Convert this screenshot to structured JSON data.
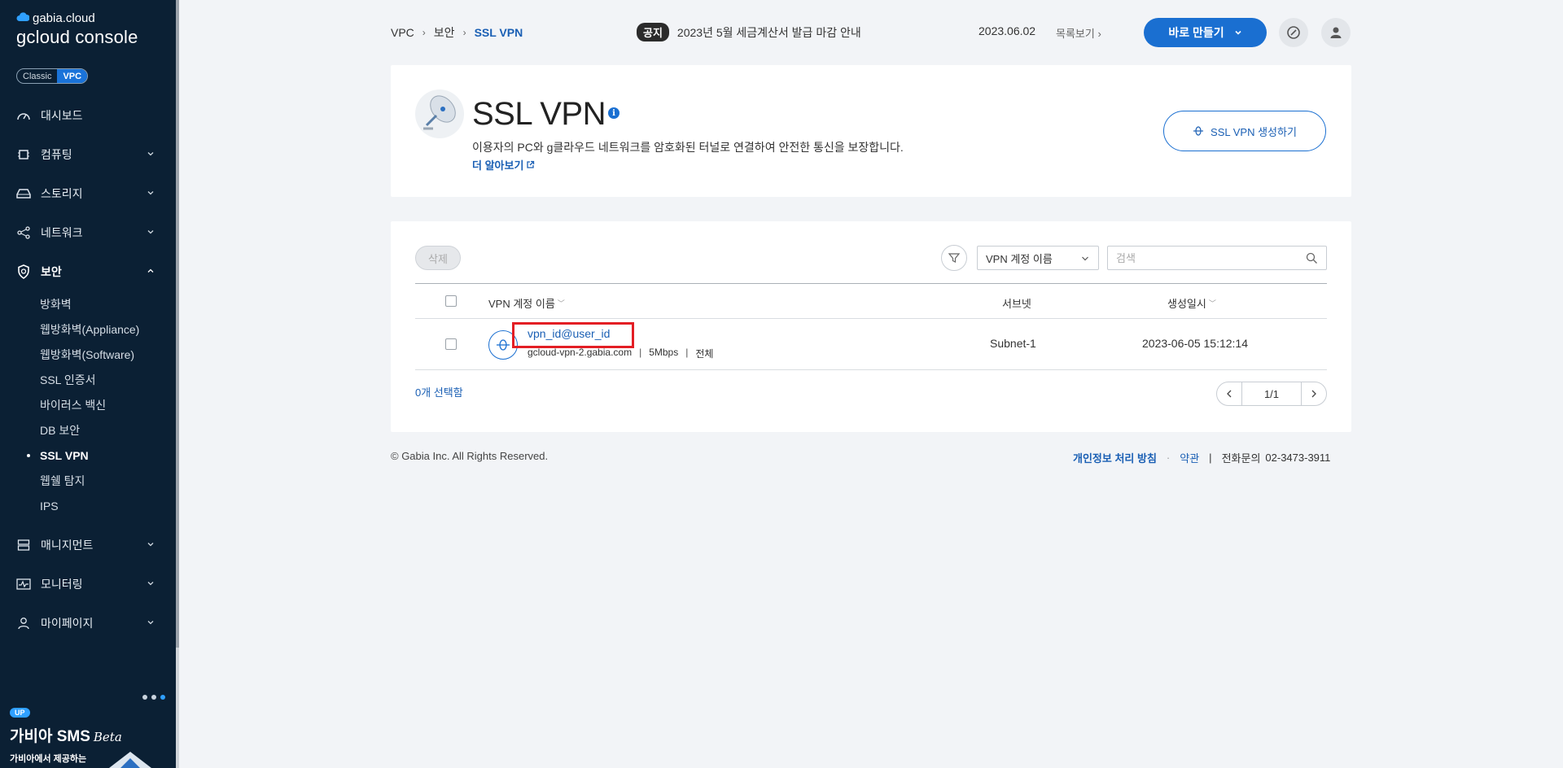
{
  "sidebar": {
    "logo_small": "gabia.cloud",
    "logo_big": "gcloud console",
    "toggle": {
      "classic": "Classic",
      "vpc": "VPC"
    },
    "items": [
      {
        "label": "대시보드"
      },
      {
        "label": "컴퓨팅"
      },
      {
        "label": "스토리지"
      },
      {
        "label": "네트워크"
      },
      {
        "label": "보안"
      }
    ],
    "security_sub": [
      {
        "label": "방화벽"
      },
      {
        "label": "웹방화벽(Appliance)"
      },
      {
        "label": "웹방화벽(Software)"
      },
      {
        "label": "SSL 인증서"
      },
      {
        "label": "바이러스 백신"
      },
      {
        "label": "DB 보안"
      },
      {
        "label": "SSL VPN"
      },
      {
        "label": "웹쉘 탐지"
      },
      {
        "label": "IPS"
      }
    ],
    "items2": [
      {
        "label": "매니지먼트"
      },
      {
        "label": "모니터링"
      },
      {
        "label": "마이페이지"
      }
    ],
    "promo": {
      "badge": "UP",
      "title": "가비아 SMS",
      "beta": "Beta",
      "sub": "가비아에서 제공하는"
    }
  },
  "header": {
    "breadcrumb": [
      "VPC",
      "보안",
      "SSL VPN"
    ],
    "notice_tag": "공지",
    "notice_text": "2023년 5월 세금계산서 발급 마감 안내",
    "notice_date": "2023.06.02",
    "more_label": "목록보기",
    "make_button": "바로 만들기"
  },
  "intro": {
    "title": "SSL VPN",
    "info": "i",
    "description": "이용자의 PC와 g클라우드 네트워크를 암호화된 터널로 연결하여 안전한 통신을 보장합니다.",
    "learn_more": "더 알아보기",
    "create_button": "SSL VPN 생성하기"
  },
  "list": {
    "delete_button": "삭제",
    "filter_select": "VPN 계정 이름",
    "search_placeholder": "검색",
    "columns": {
      "name": "VPN 계정 이름",
      "subnet": "서브넷",
      "created": "생성일시"
    },
    "rows": [
      {
        "account": "vpn_id@user_id",
        "host": "gcloud-vpn-2.gabia.com",
        "bandwidth": "5Mbps",
        "scope": "전체",
        "subnet": "Subnet-1",
        "created": "2023-06-05 15:12:14"
      }
    ],
    "selected_count": "0개 선택함",
    "page": "1/1"
  },
  "footer": {
    "copyright": "© Gabia Inc. All Rights Reserved.",
    "privacy": "개인정보 처리 방침",
    "terms": "약관",
    "phone_label": "전화문의",
    "phone": "02-3473-3911"
  },
  "colors": {
    "sidebar_bg": "#0b2034",
    "accent": "#1a6fd1",
    "highlight": "#e31e24"
  }
}
